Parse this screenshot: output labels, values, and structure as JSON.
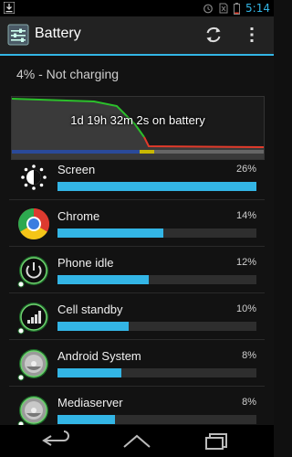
{
  "status_bar": {
    "time": "5:14"
  },
  "action_bar": {
    "title": "Battery"
  },
  "summary": "4% - Not charging",
  "graph": {
    "label": "1d 19h 32m 2s on battery"
  },
  "items": [
    {
      "name": "Screen",
      "percent_text": "26%",
      "fraction": 1.0,
      "icon": "screen-brightness-icon"
    },
    {
      "name": "Chrome",
      "percent_text": "14%",
      "fraction": 0.53,
      "icon": "chrome-icon"
    },
    {
      "name": "Phone idle",
      "percent_text": "12%",
      "fraction": 0.46,
      "icon": "power-icon"
    },
    {
      "name": "Cell standby",
      "percent_text": "10%",
      "fraction": 0.36,
      "icon": "signal-icon"
    },
    {
      "name": "Android System",
      "percent_text": "8%",
      "fraction": 0.32,
      "icon": "android-system-icon"
    },
    {
      "name": "Mediaserver",
      "percent_text": "8%",
      "fraction": 0.29,
      "icon": "mediaserver-icon"
    }
  ],
  "colors": {
    "accent": "#33b5e5",
    "graph_good": "#2bbf2b",
    "graph_low": "#e23b2b"
  }
}
